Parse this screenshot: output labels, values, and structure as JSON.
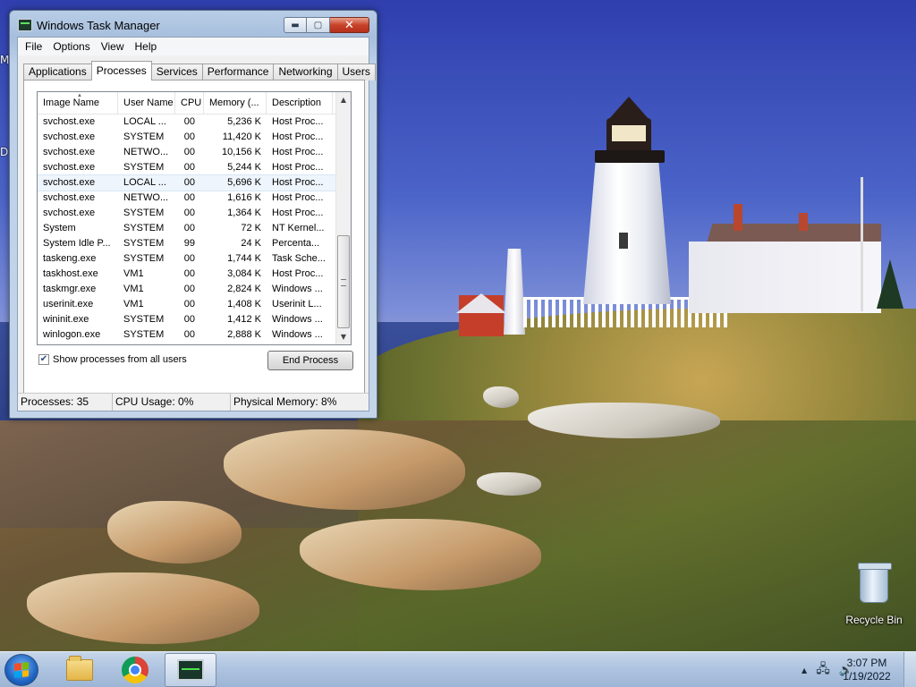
{
  "window": {
    "title": "Windows Task Manager",
    "icon": "task-manager-icon",
    "min_glyph": "▬",
    "max_glyph": "▢",
    "close_glyph": "✕"
  },
  "menu": [
    "File",
    "Options",
    "View",
    "Help"
  ],
  "tabs": [
    "Applications",
    "Processes",
    "Services",
    "Performance",
    "Networking",
    "Users"
  ],
  "active_tab": "Processes",
  "columns": [
    "Image Name",
    "User Name",
    "CPU",
    "Memory (...",
    "Description"
  ],
  "sort_indicator": "▲",
  "processes": [
    {
      "name": "svchost.exe",
      "user": "LOCAL ...",
      "cpu": "00",
      "mem": "5,236 K",
      "desc": "Host Proc..."
    },
    {
      "name": "svchost.exe",
      "user": "SYSTEM",
      "cpu": "00",
      "mem": "11,420 K",
      "desc": "Host Proc..."
    },
    {
      "name": "svchost.exe",
      "user": "NETWO...",
      "cpu": "00",
      "mem": "10,156 K",
      "desc": "Host Proc..."
    },
    {
      "name": "svchost.exe",
      "user": "SYSTEM",
      "cpu": "00",
      "mem": "5,244 K",
      "desc": "Host Proc..."
    },
    {
      "name": "svchost.exe",
      "user": "LOCAL ...",
      "cpu": "00",
      "mem": "5,696 K",
      "desc": "Host Proc..."
    },
    {
      "name": "svchost.exe",
      "user": "NETWO...",
      "cpu": "00",
      "mem": "1,616 K",
      "desc": "Host Proc..."
    },
    {
      "name": "svchost.exe",
      "user": "SYSTEM",
      "cpu": "00",
      "mem": "1,364 K",
      "desc": "Host Proc..."
    },
    {
      "name": "System",
      "user": "SYSTEM",
      "cpu": "00",
      "mem": "72 K",
      "desc": "NT Kernel..."
    },
    {
      "name": "System Idle P...",
      "user": "SYSTEM",
      "cpu": "99",
      "mem": "24 K",
      "desc": "Percenta..."
    },
    {
      "name": "taskeng.exe",
      "user": "SYSTEM",
      "cpu": "00",
      "mem": "1,744 K",
      "desc": "Task Sche..."
    },
    {
      "name": "taskhost.exe",
      "user": "VM1",
      "cpu": "00",
      "mem": "3,084 K",
      "desc": "Host Proc..."
    },
    {
      "name": "taskmgr.exe",
      "user": "VM1",
      "cpu": "00",
      "mem": "2,824 K",
      "desc": "Windows ..."
    },
    {
      "name": "userinit.exe",
      "user": "VM1",
      "cpu": "00",
      "mem": "1,408 K",
      "desc": "Userinit L..."
    },
    {
      "name": "wininit.exe",
      "user": "SYSTEM",
      "cpu": "00",
      "mem": "1,412 K",
      "desc": "Windows ..."
    },
    {
      "name": "winlogon.exe",
      "user": "SYSTEM",
      "cpu": "00",
      "mem": "2,888 K",
      "desc": "Windows ..."
    }
  ],
  "hover_row_index": 4,
  "scroll": {
    "up_glyph": "▲",
    "down_glyph": "▼"
  },
  "show_all_users": {
    "label": "Show processes from all users",
    "checked": true,
    "check_glyph": "✔"
  },
  "end_process_label": "End Process",
  "status": {
    "processes": "Processes: 35",
    "cpu": "CPU Usage: 0%",
    "memory": "Physical Memory: 8%"
  },
  "desktop": {
    "recycle_bin_label": "Recycle Bin",
    "clipped_left_labels": [
      "M",
      "D"
    ]
  },
  "taskbar": {
    "clock_time": "3:07 PM",
    "clock_date": "1/19/2022",
    "tray_glyphs": {
      "chevron": "▲",
      "network": "🖧",
      "volume": "🔊"
    },
    "flag_colors": [
      "#f25022",
      "#7fba00",
      "#00a4ef",
      "#ffb900"
    ]
  }
}
